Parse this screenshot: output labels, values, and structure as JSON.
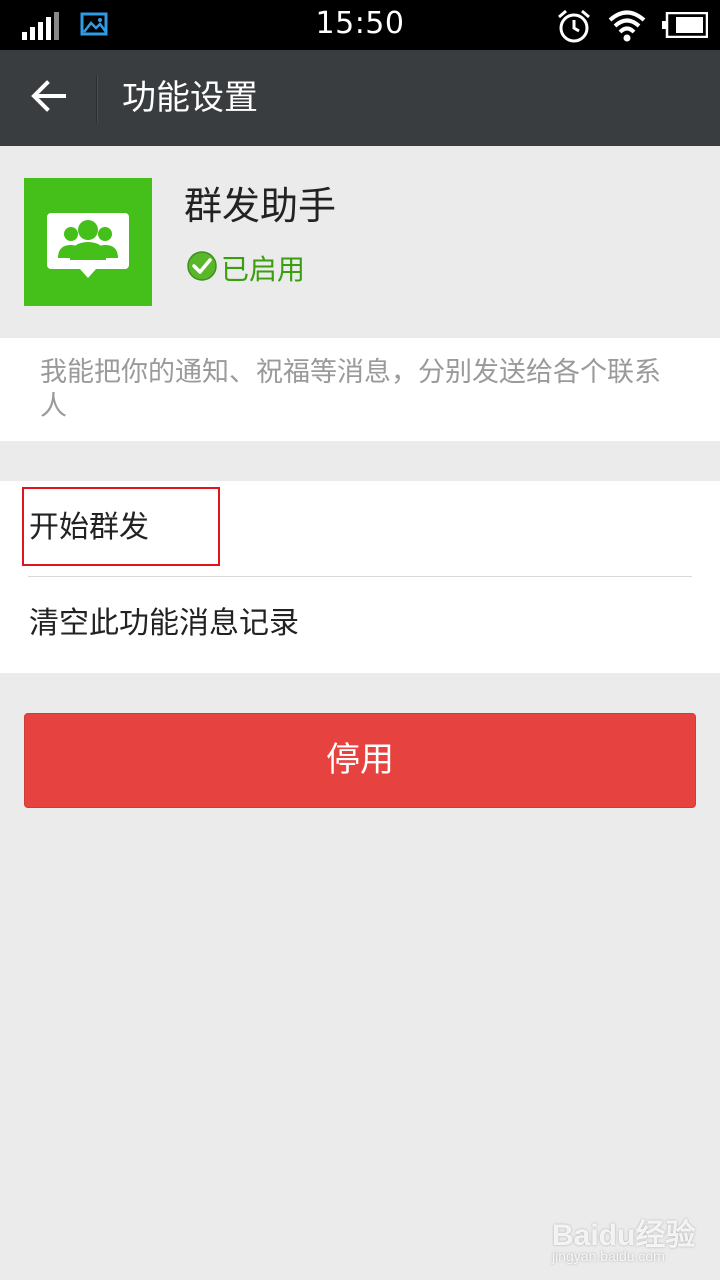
{
  "status_bar": {
    "time": "15:50",
    "icons": [
      "signal-icon",
      "gallery-notification-icon",
      "alarm-icon",
      "wifi-icon",
      "battery-icon"
    ]
  },
  "app_bar": {
    "title": "功能设置",
    "back_icon": "back-arrow-icon"
  },
  "plugin": {
    "name": "群发助手",
    "status": "已启用",
    "icon": "group-chat-icon",
    "icon_color": "#45c01a",
    "status_color": "#3b9e0f"
  },
  "description": "我能把你的通知、祝福等消息，分别发送给各个联系人",
  "menu": {
    "items": [
      {
        "label": "开始群发"
      },
      {
        "label": "清空此功能消息记录"
      }
    ]
  },
  "disable_button": {
    "label": "停用",
    "color": "#e64340"
  },
  "watermark": {
    "brand": "Baidu经验",
    "url": "jingyan.baidu.com"
  }
}
